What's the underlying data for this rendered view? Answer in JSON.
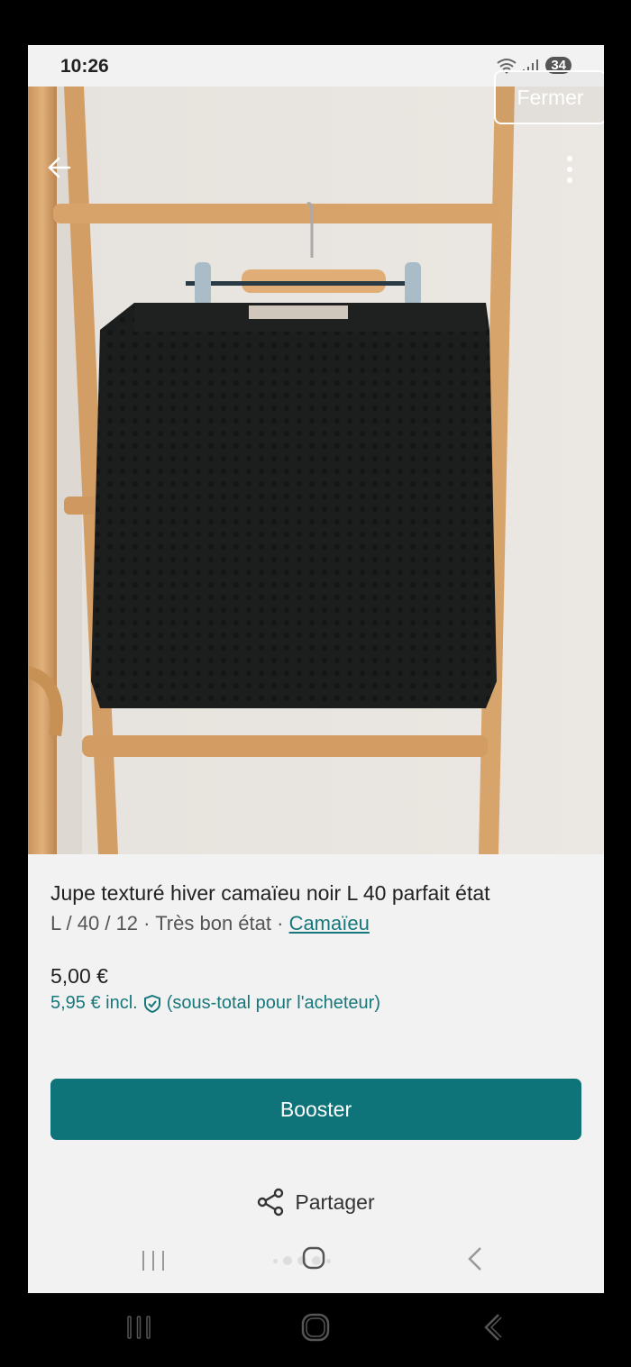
{
  "status_bar": {
    "time": "10:26",
    "battery": "34"
  },
  "photo": {
    "close_label": "Fermer",
    "carousel": {
      "total": 5,
      "active_index": 0
    }
  },
  "item": {
    "title": "Jupe texturé hiver camaïeu noir L 40 parfait état",
    "meta": "L / 40 / 12 · Très bon état · ",
    "brand": "Camaïeu",
    "price": "5,00 €",
    "price_incl": "5,95 €  incl.",
    "price_note": "(sous-total pour l'acheteur)"
  },
  "actions": {
    "booster_label": "Booster",
    "share_label": "Partager"
  },
  "icons": {
    "back": "arrow-left-icon",
    "more": "more-vertical-icon",
    "shield": "shield-check-icon",
    "share": "share-icon",
    "recent_apps": "recent-apps-icon",
    "home": "home-icon",
    "nav_back": "chevron-left-icon"
  },
  "colors": {
    "accent": "#0f7479",
    "link": "#16787c"
  }
}
